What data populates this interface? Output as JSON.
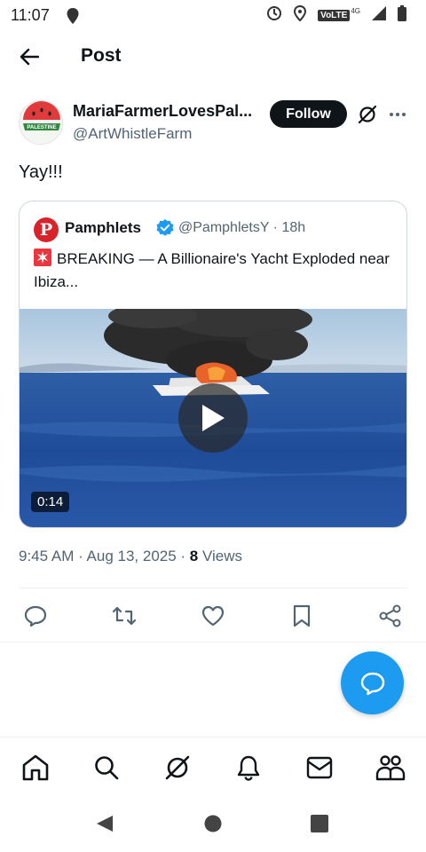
{
  "status_bar": {
    "time": "11:07",
    "network_label": "VoLTE",
    "network_type": "4G",
    "icons": [
      "notification-icon",
      "sync-icon",
      "location-icon",
      "signal-icon",
      "battery-icon"
    ]
  },
  "header": {
    "title": "Post",
    "back_icon": "arrow-left-icon"
  },
  "author": {
    "name": "MariaFarmerLovesPal...",
    "handle": "@ArtWhistleFarm",
    "avatar_text": "PALESTINE",
    "follow_label": "Follow"
  },
  "post": {
    "text": "Yay!!!",
    "timestamp": "9:45 AM · Aug 13, 2025",
    "separator": " · ",
    "views_count": "8",
    "views_label": " Views"
  },
  "quote": {
    "avatar_letter": "P",
    "name": "Pamphlets",
    "handle_time": "@PamphletsY · 18h",
    "text": "BREAKING — A Billionaire's Yacht Exploded near Ibiza...",
    "video_duration": "0:14"
  },
  "actions": [
    "reply-icon",
    "repost-icon",
    "like-icon",
    "bookmark-icon",
    "share-icon"
  ],
  "bottom_nav": [
    "home-icon",
    "search-icon",
    "grok-icon",
    "notifications-icon",
    "messages-icon",
    "communities-icon"
  ],
  "colors": {
    "accent": "#1d9bf0",
    "text": "#0f1419",
    "muted": "#536471",
    "border": "#cfd9de",
    "quote_avatar": "#d8232a"
  }
}
